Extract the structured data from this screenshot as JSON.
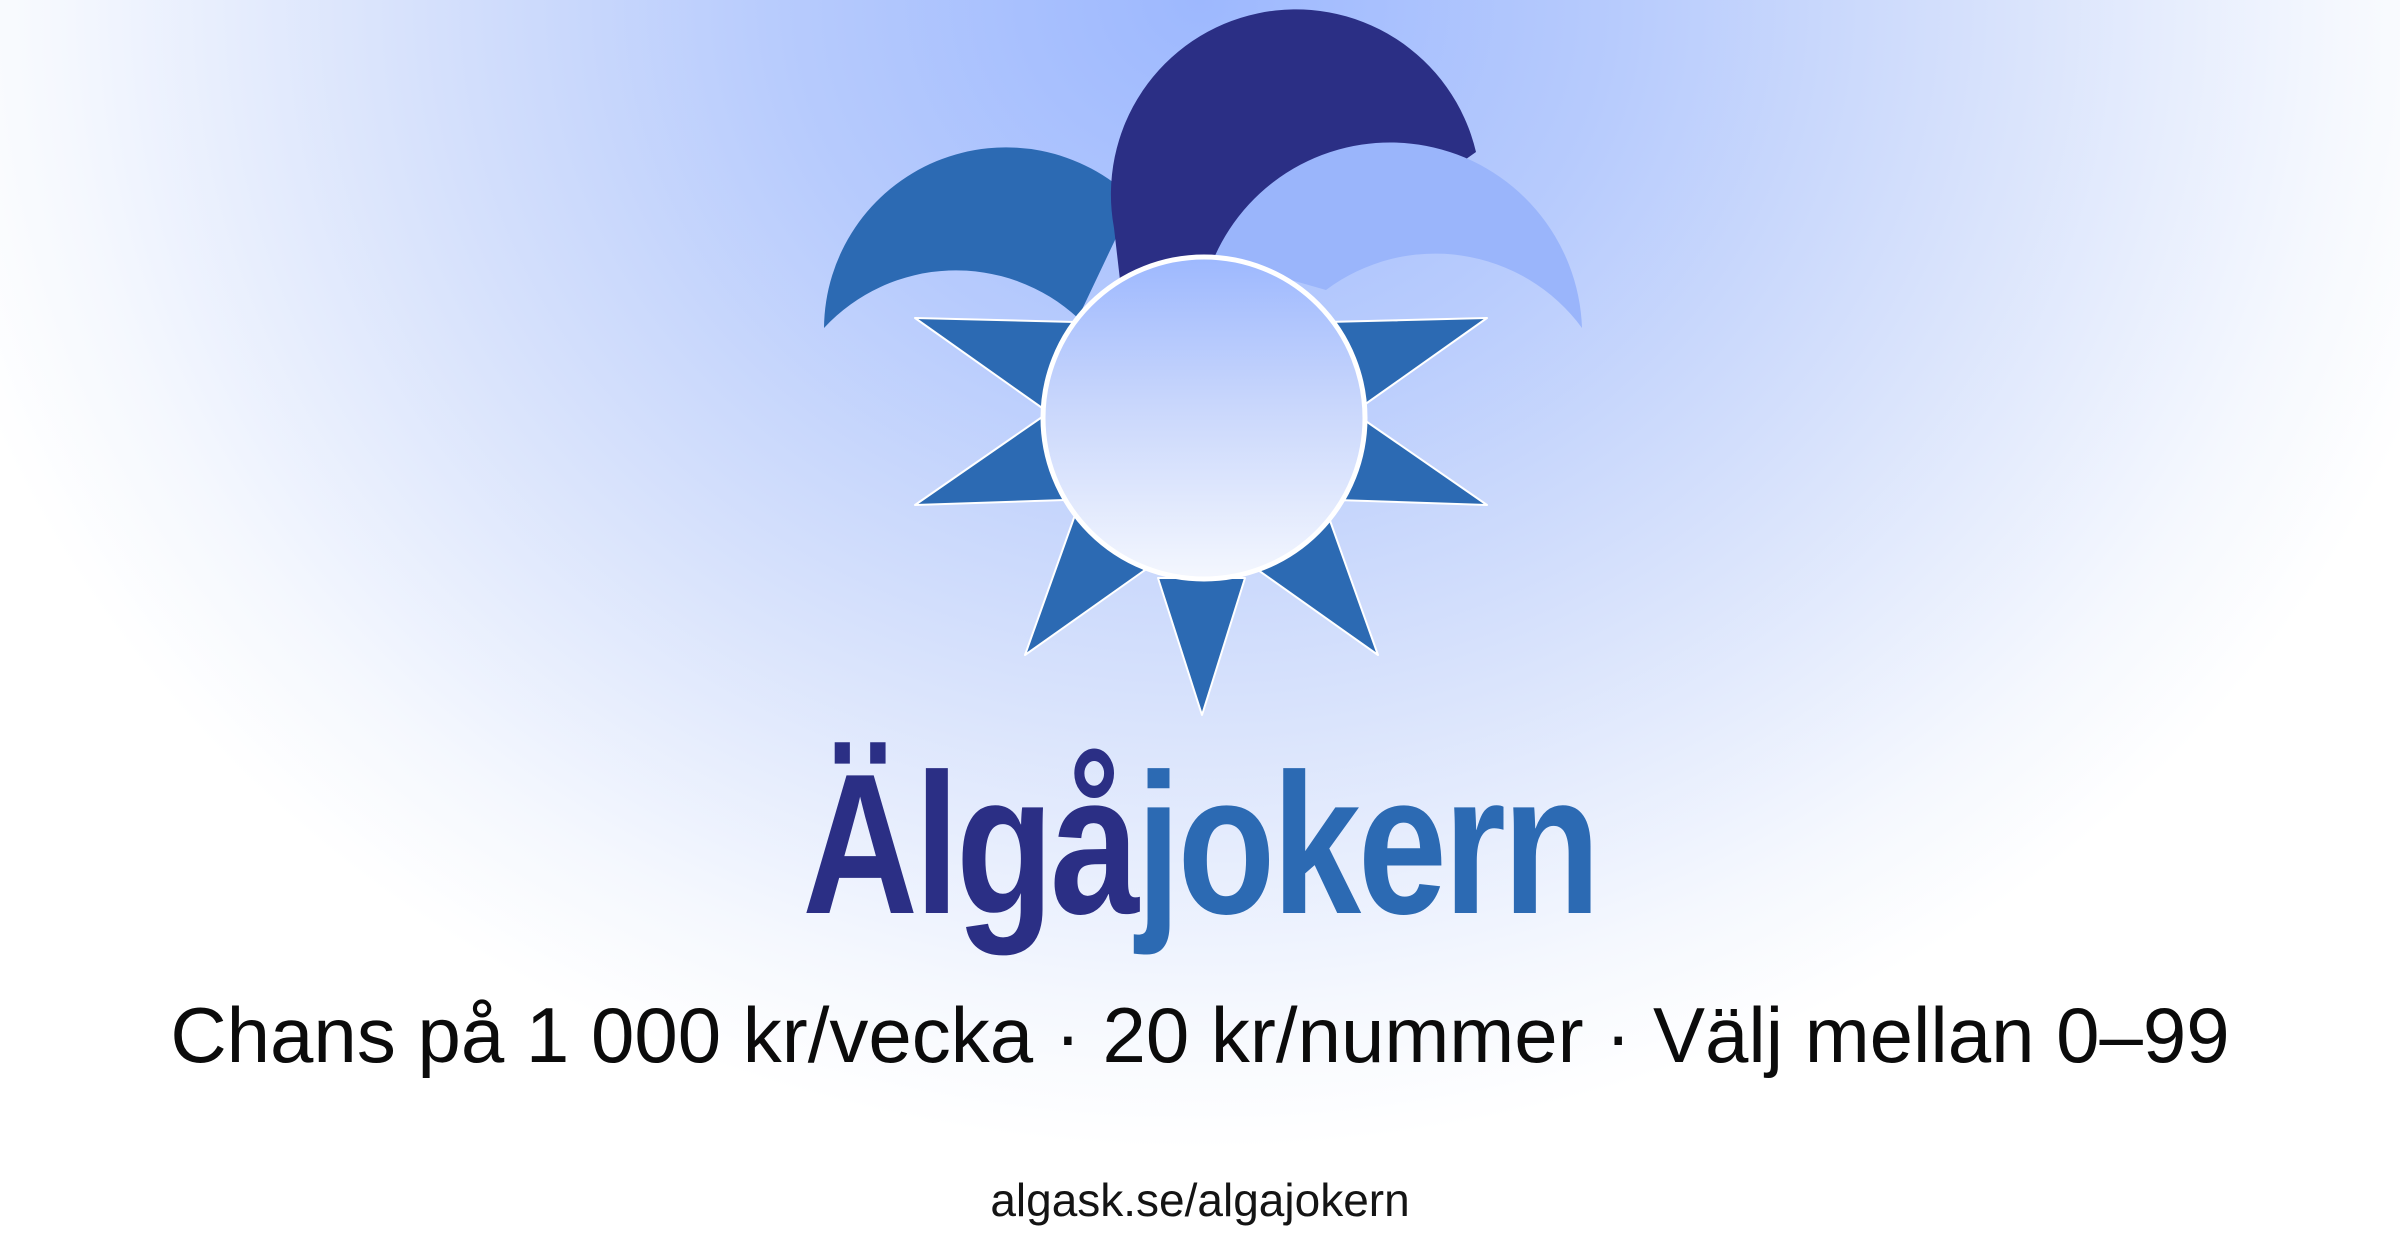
{
  "brand": {
    "name_part1": "Älgå",
    "name_part2": "jokern",
    "color_primary": "#2b2f85",
    "color_secondary": "#2c6ab3",
    "color_light": "#9ab5fb"
  },
  "tagline": "Chans på 1 000 kr/vecka · 20 kr/nummer · Välj mellan 0–99",
  "url": "algask.se/algajokern",
  "logo": {
    "icon": "jester-hat-sun-logo"
  }
}
